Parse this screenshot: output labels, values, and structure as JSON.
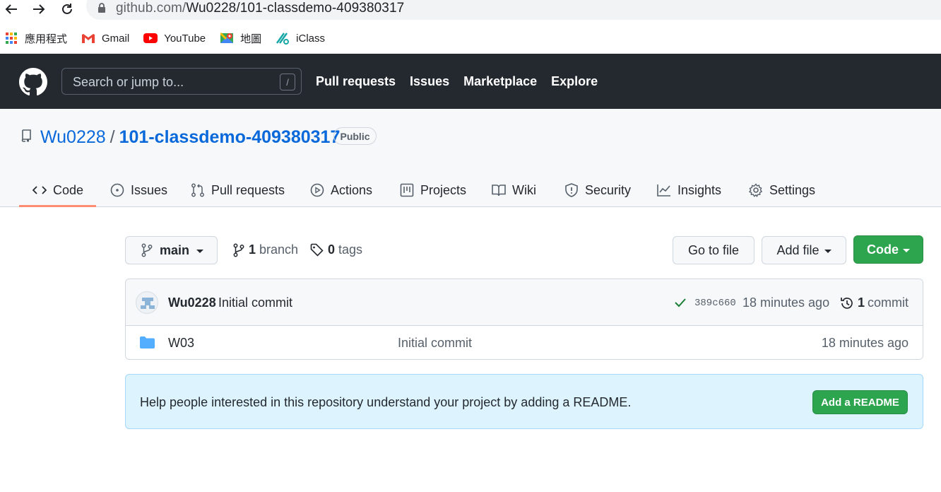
{
  "browser": {
    "url_host": "github.com/",
    "url_path": "Wu0228/101-classdemo-409380317",
    "bookmarks": [
      {
        "label": "應用程式",
        "icon": "apps-grid-icon"
      },
      {
        "label": "Gmail",
        "icon": "gmail-icon"
      },
      {
        "label": "YouTube",
        "icon": "youtube-icon"
      },
      {
        "label": "地圖",
        "icon": "maps-icon"
      },
      {
        "label": "iClass",
        "icon": "iclass-icon"
      }
    ]
  },
  "header": {
    "search_placeholder": "Search or jump to...",
    "search_shortcut": "/",
    "nav": [
      "Pull requests",
      "Issues",
      "Marketplace",
      "Explore"
    ]
  },
  "repo": {
    "owner": "Wu0228",
    "separator": "/",
    "name": "101-classdemo-409380317",
    "visibility": "Public"
  },
  "tabs": [
    {
      "label": "Code",
      "icon": "code-icon",
      "active": true
    },
    {
      "label": "Issues",
      "icon": "issue-icon"
    },
    {
      "label": "Pull requests",
      "icon": "pull-request-icon"
    },
    {
      "label": "Actions",
      "icon": "play-icon"
    },
    {
      "label": "Projects",
      "icon": "project-icon"
    },
    {
      "label": "Wiki",
      "icon": "book-icon"
    },
    {
      "label": "Security",
      "icon": "shield-icon"
    },
    {
      "label": "Insights",
      "icon": "graph-icon"
    },
    {
      "label": "Settings",
      "icon": "gear-icon"
    }
  ],
  "branch_bar": {
    "branch": "main",
    "branch_count": "1",
    "branch_label": "branch",
    "tag_count": "0",
    "tag_label": "tags",
    "goto_file": "Go to file",
    "add_file": "Add file",
    "code": "Code"
  },
  "latest_commit": {
    "author": "Wu0228",
    "message": "Initial commit",
    "sha": "389c660",
    "time": "18 minutes ago",
    "commit_count": "1",
    "commit_label": "commit"
  },
  "files": [
    {
      "name": "W03",
      "type": "folder",
      "message": "Initial commit",
      "time": "18 minutes ago"
    }
  ],
  "readme_prompt": {
    "text": "Help people interested in this repository understand your project by adding a README.",
    "button": "Add a README"
  },
  "colors": {
    "header_bg": "#24292f",
    "link_blue": "#0969da",
    "primary_green": "#2da44e",
    "tab_underline": "#fd8c73",
    "readme_bg": "#ddf4ff"
  }
}
